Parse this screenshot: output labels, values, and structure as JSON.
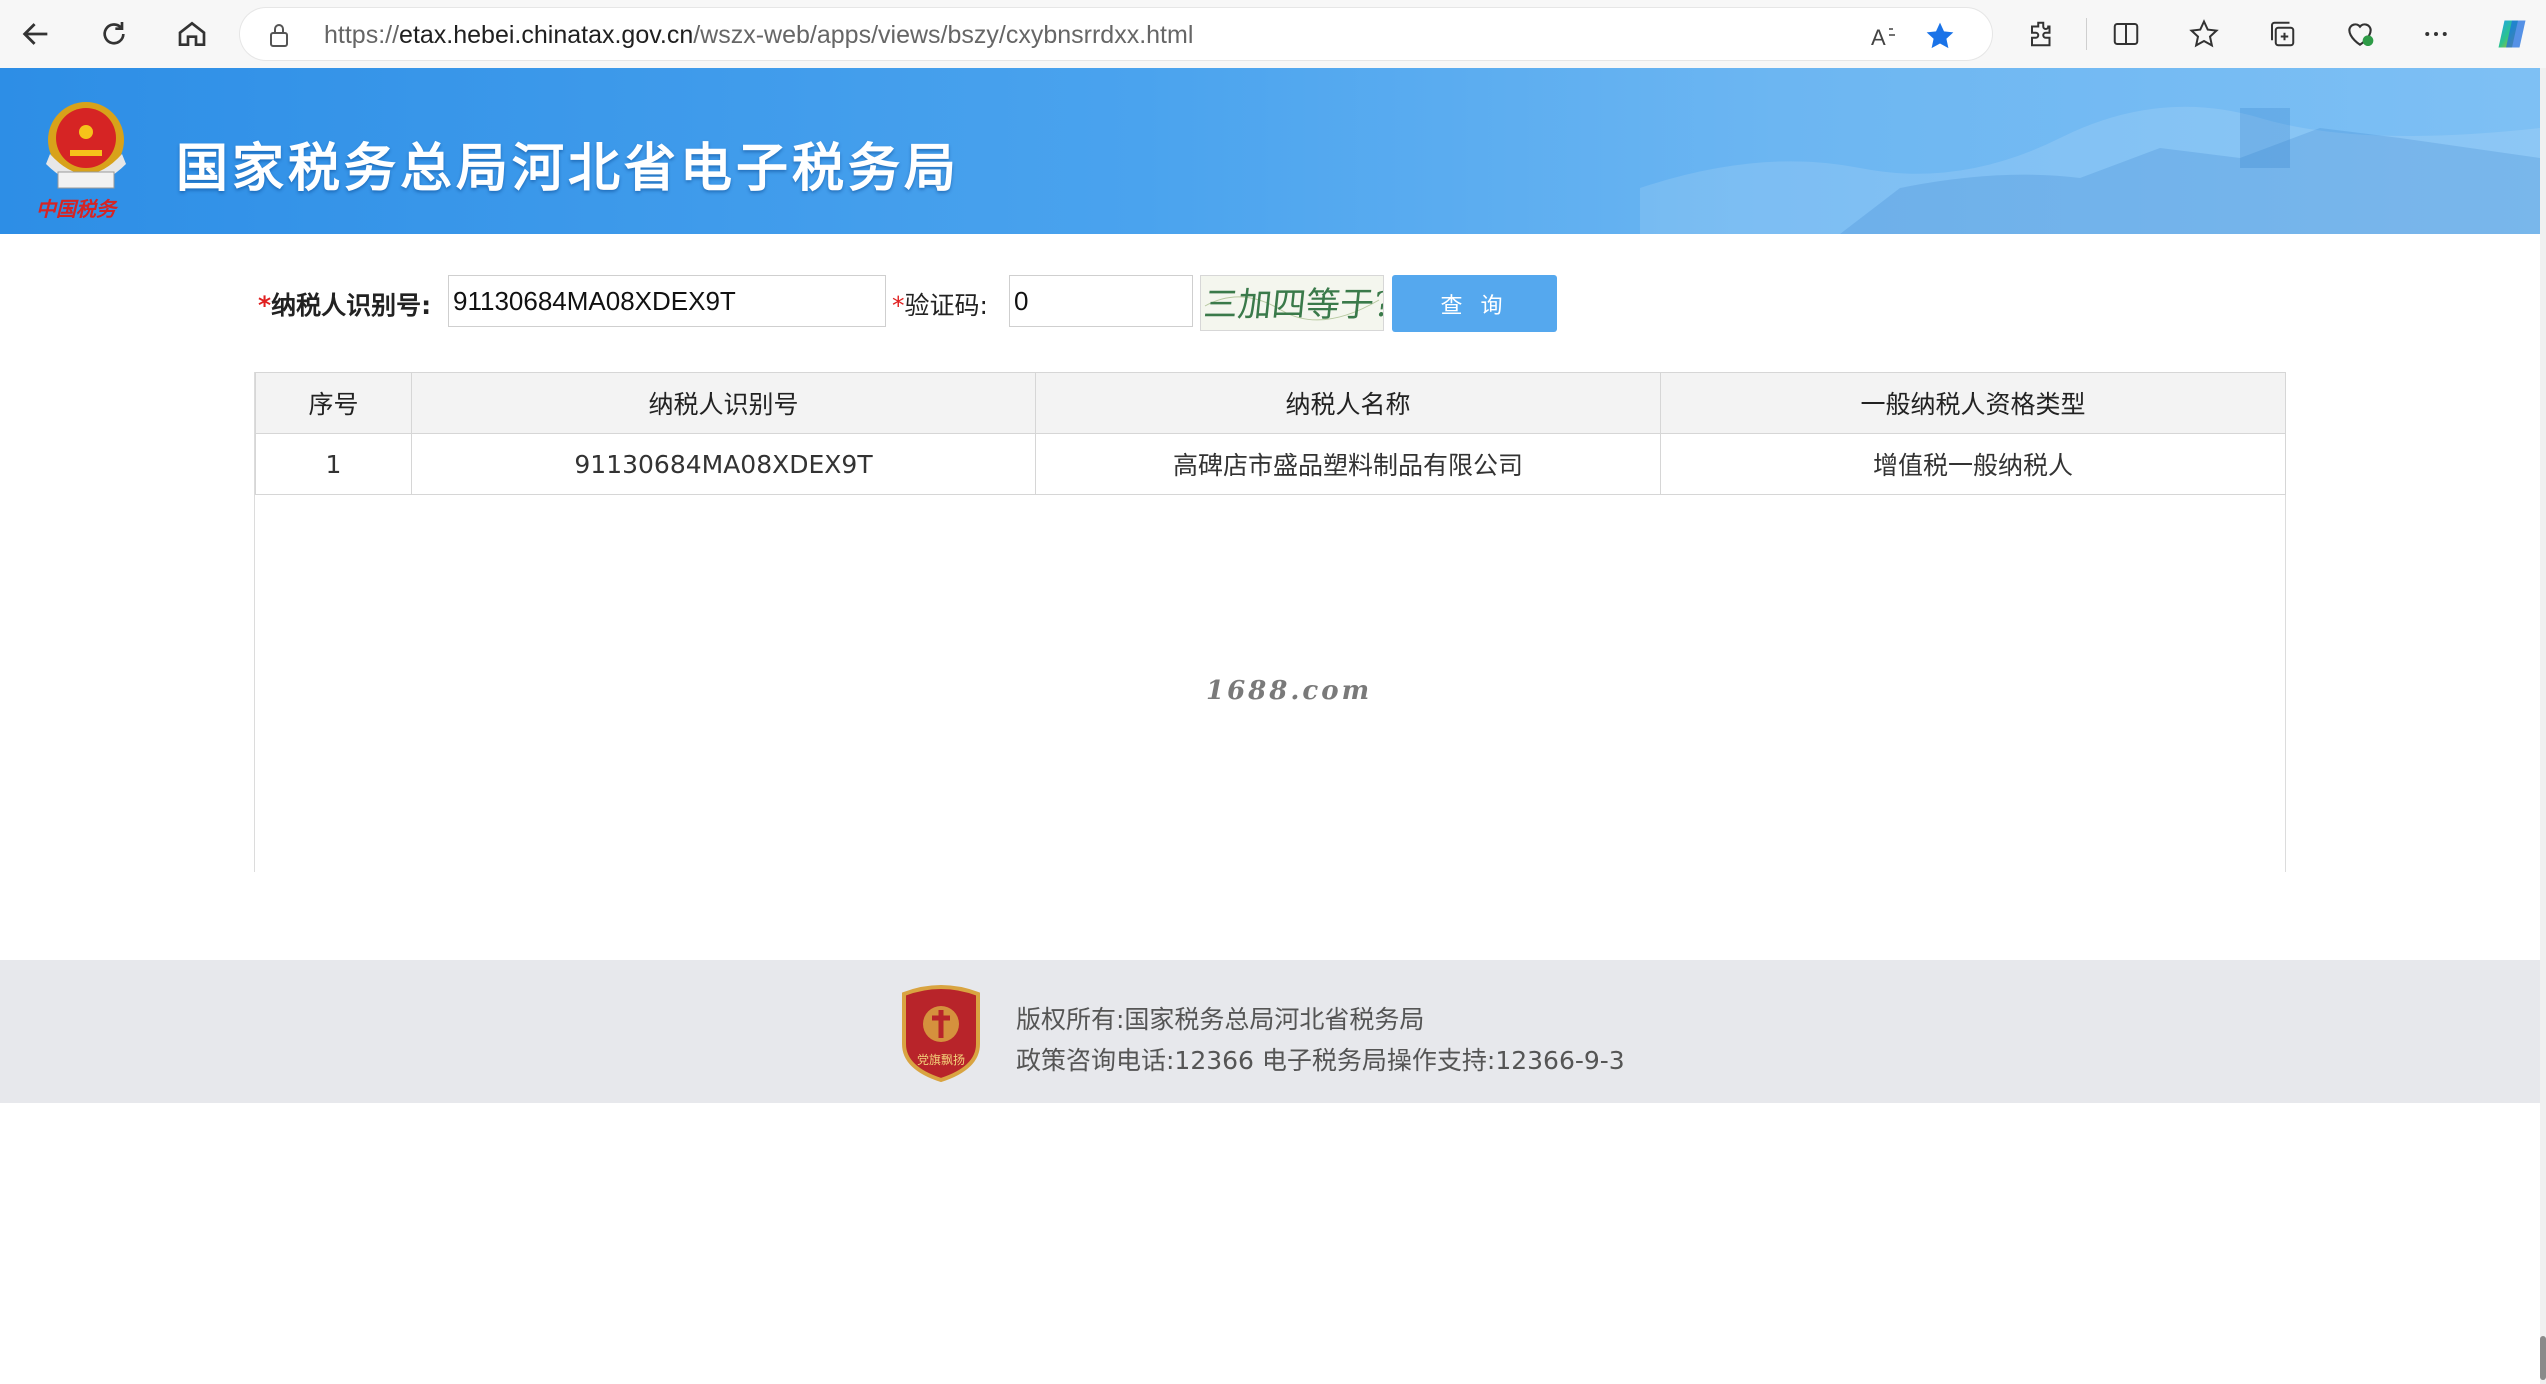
{
  "browser": {
    "url_prefix": "https://",
    "url_host": "etax.hebei.chinatax.gov.cn",
    "url_path": "/wszx-web/apps/views/bszy/cxybnsrrdxx.html"
  },
  "header": {
    "site_title": "国家税务总局河北省电子税务局",
    "emblem_caption": "中国税务"
  },
  "form": {
    "taxpayer_id_label": "纳税人识别号:",
    "taxpayer_id_value": "91130684MA08XDEX9T",
    "captcha_label": "验证码:",
    "captcha_value": "0",
    "captcha_image_text": "三加四等于?",
    "query_button": "查 询",
    "required_mark": "*"
  },
  "table": {
    "columns": [
      "序号",
      "纳税人识别号",
      "纳税人名称",
      "一般纳税人资格类型"
    ],
    "rows": [
      [
        "1",
        "91130684MA08XDEX9T",
        "高碑店市盛品塑料制品有限公司",
        "增值税一般纳税人"
      ]
    ]
  },
  "watermark": "1688.com",
  "footer": {
    "copyright": "版权所有:国家税务总局河北省税务局",
    "contact": "政策咨询电话:12366  电子税务局操作支持:12366-9-3",
    "badge_text": "党旗飘扬"
  },
  "colors": {
    "banner_blue": "#2d8ee6",
    "button_blue": "#55a8ee",
    "required_red": "#e02020",
    "favorite_star": "#1a73e8"
  }
}
